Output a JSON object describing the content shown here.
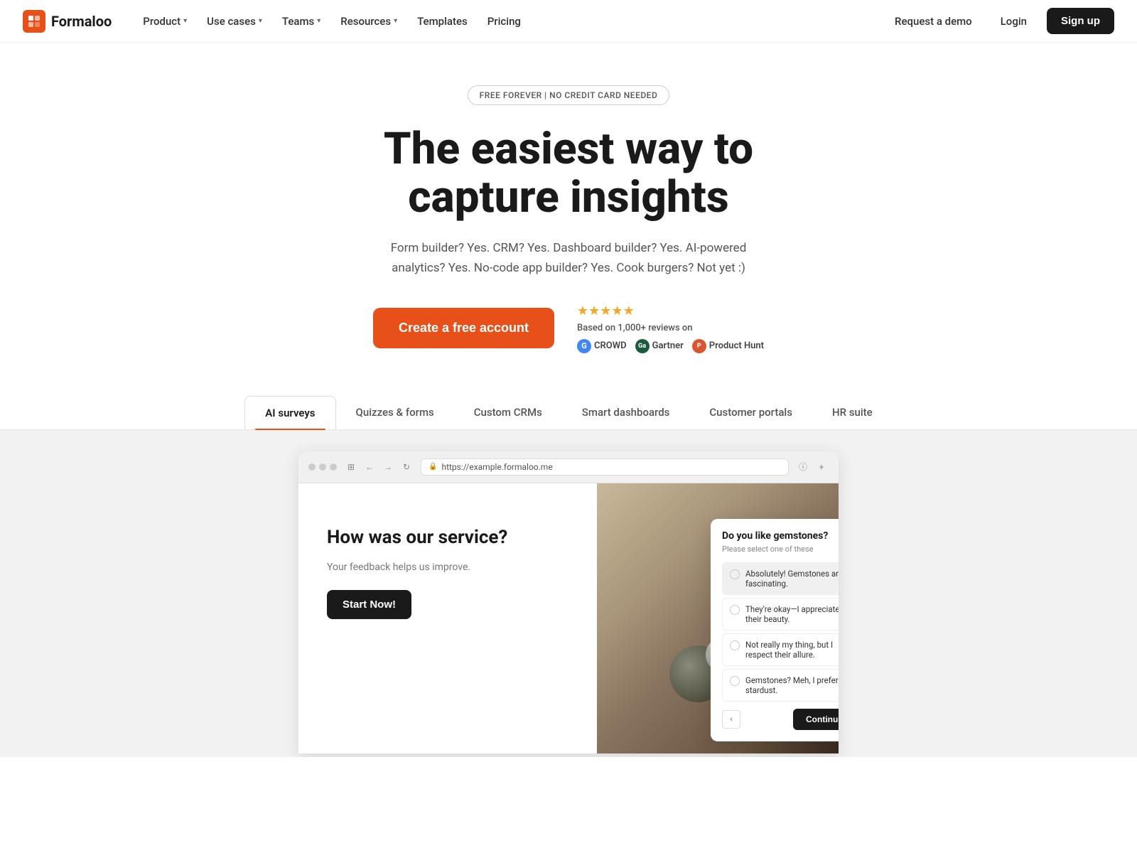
{
  "brand": {
    "name": "Formaloo",
    "logo_alt": "Formaloo logo"
  },
  "navbar": {
    "items": [
      {
        "id": "product",
        "label": "Product",
        "has_dropdown": true
      },
      {
        "id": "use-cases",
        "label": "Use cases",
        "has_dropdown": true
      },
      {
        "id": "teams",
        "label": "Teams",
        "has_dropdown": true
      },
      {
        "id": "resources",
        "label": "Resources",
        "has_dropdown": true
      },
      {
        "id": "templates",
        "label": "Templates",
        "has_dropdown": false
      },
      {
        "id": "pricing",
        "label": "Pricing",
        "has_dropdown": false
      }
    ],
    "right": {
      "demo_label": "Request a demo",
      "login_label": "Login",
      "signup_label": "Sign up"
    }
  },
  "hero": {
    "badge": "FREE FOREVER | NO CREDIT CARD NEEDED",
    "title_line1": "The easiest way to",
    "title_line2": "capture insights",
    "subtitle": "Form builder? Yes. CRM? Yes. Dashboard builder? Yes. AI-powered analytics? Yes. No-code app builder? Yes. Cook burgers? Not yet :)",
    "cta_label": "Create a free account",
    "reviews": {
      "label": "Based on 1,000+ reviews on",
      "platforms": [
        {
          "id": "g-crowd",
          "label": "CROWD"
        },
        {
          "id": "gartner",
          "label": "Gartner"
        },
        {
          "id": "product-hunt",
          "label": "Product Hunt"
        }
      ]
    }
  },
  "tabs": [
    {
      "id": "ai-surveys",
      "label": "AI surveys",
      "active": true
    },
    {
      "id": "quizzes-forms",
      "label": "Quizzes & forms",
      "active": false
    },
    {
      "id": "custom-crms",
      "label": "Custom CRMs",
      "active": false
    },
    {
      "id": "smart-dashboards",
      "label": "Smart dashboards",
      "active": false
    },
    {
      "id": "customer-portals",
      "label": "Customer portals",
      "active": false
    },
    {
      "id": "hr-suite",
      "label": "HR suite",
      "active": false
    }
  ],
  "preview": {
    "browser_url": "https://example.formaloo.me",
    "survey_title": "How was our service?",
    "survey_subtitle": "Your feedback helps us improve.",
    "start_button": "Start Now!",
    "overlay": {
      "title": "Do you like gemstones?",
      "subtitle": "Please select one of these",
      "options": [
        {
          "id": "opt1",
          "label": "Absolutely! Gemstones are fascinating.",
          "selected": true
        },
        {
          "id": "opt2",
          "label": "They're okay—I appreciate their beauty.",
          "selected": false
        },
        {
          "id": "opt3",
          "label": "Not really my thing, but I respect their allure.",
          "selected": false
        },
        {
          "id": "opt4",
          "label": "Gemstones? Meh, I prefer stardust.",
          "selected": false
        }
      ],
      "continue_label": "Continue",
      "nav_prev": "‹",
      "nav_next": "›"
    }
  }
}
